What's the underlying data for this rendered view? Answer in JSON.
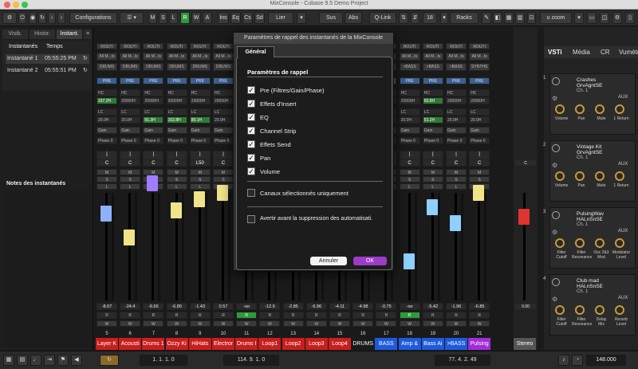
{
  "window": {
    "title": "MixConsole - Cubase 9.5 Demo Project"
  },
  "toolbar": {
    "configurations": "Configurations",
    "modes": [
      "M",
      "S",
      "L",
      "R",
      "W",
      "A"
    ],
    "ins": "Ins",
    "eq": "Eq",
    "cs": "Cs",
    "sd": "Sd",
    "link": "Lier",
    "sus": "Sus",
    "abs": "Abs",
    "qlink": "Q-Link",
    "channels": "18",
    "racks": "Racks",
    "zoom": "u zoom"
  },
  "left": {
    "tabs": [
      "Visib.",
      "Histor.",
      "Instant."
    ],
    "headers": [
      "Instantanés",
      "Temps"
    ],
    "snapshots": [
      {
        "name": "Instantané 1",
        "time": "05:55:25 PM"
      },
      {
        "name": "Instantané 2",
        "time": "05:55:51 PM"
      }
    ],
    "notes_label": "Notes des instantanés"
  },
  "colors": {
    "accent": "#2e9a3a",
    "dialog_ok": "#9b3cc7"
  },
  "channels": [
    {
      "num": "5",
      "name": "Layer K",
      "color": "#c81e1e",
      "fader_color": "#8fb0ff",
      "level": "-8.07",
      "peak": "-1.5",
      "pan": "C"
    },
    {
      "num": "6",
      "name": "Acousti",
      "color": "#c81e1e",
      "fader_color": "#f0e38a",
      "level": "-24.4",
      "peak": "-20.3",
      "pan": "C"
    },
    {
      "num": "7",
      "name": "Drums 1",
      "color": "#c81e1e",
      "fader_color": "#a27bff",
      "level": "-6.65",
      "peak": "-4.56",
      "pan": "C"
    },
    {
      "num": "8",
      "name": "Ozzy Ki",
      "color": "#c81e1e",
      "fader_color": "#f0e38a",
      "level": "-6.89",
      "peak": "-5.7",
      "pan": "C"
    },
    {
      "num": "9",
      "name": "HiHats",
      "color": "#c81e1e",
      "fader_color": "#f0e38a",
      "level": "-1.43",
      "peak": "-1.43",
      "pan": "L50"
    },
    {
      "num": "10",
      "name": "Electror",
      "color": "#c81e1e",
      "fader_color": "#f0e38a",
      "level": "0.57",
      "peak": "-6.6",
      "pan": "C"
    },
    {
      "num": "11",
      "name": "Drums I",
      "color": "#c81e1e",
      "fader_color": "#a34fd8",
      "level": "-oo",
      "peak": "-oo",
      "pan": "C"
    },
    {
      "num": "12",
      "name": "Loop1",
      "color": "#c81e1e",
      "fader_color": "#f0e38a",
      "level": "-12.9",
      "peak": "-oo",
      "pan": "C"
    },
    {
      "num": "13",
      "name": "Loop2",
      "color": "#c81e1e",
      "fader_color": "#f0e38a",
      "level": "-2.85",
      "peak": "-oo",
      "pan": "C"
    },
    {
      "num": "14",
      "name": "Loop3",
      "color": "#c81e1e",
      "fader_color": "#f0e38a",
      "level": "-6.96",
      "peak": "-oo",
      "pan": "C"
    },
    {
      "num": "15",
      "name": "Loop4",
      "color": "#c81e1e",
      "fader_color": "#f0e38a",
      "level": "-4.11",
      "peak": "-oo",
      "pan": "C"
    },
    {
      "num": "16",
      "name": "DRUMS",
      "color": "#1a1a1a",
      "fader_color": "#f0e38a",
      "level": "-4.98",
      "peak": "-5.6",
      "pan": "C"
    },
    {
      "num": "17",
      "name": "BASS",
      "color": "#1e5adc",
      "fader_color": "#8fd0ff",
      "level": "-0.75",
      "peak": "-7.9",
      "pan": "C"
    },
    {
      "num": "18",
      "name": "Amp &",
      "color": "#1e5adc",
      "fader_color": "#8fd0ff",
      "level": "-oo",
      "peak": "-29.3",
      "pan": "C"
    },
    {
      "num": "19",
      "name": "Bass Ai",
      "color": "#1e5adc",
      "fader_color": "#8fd0ff",
      "level": "-5.42",
      "peak": "-12.5",
      "pan": "C"
    },
    {
      "num": "20",
      "name": ">BASS",
      "color": "#1e5adc",
      "fader_color": "#8fd0ff",
      "level": "-1.96",
      "peak": "-9.6",
      "pan": "C"
    },
    {
      "num": "21",
      "name": "Pulsing",
      "color": "#a02dd8",
      "fader_color": "#f0e38a",
      "level": "-6.85",
      "peak": "-8.99",
      "pan": "C"
    }
  ],
  "stereo": {
    "name": "Stereo",
    "level": "0.00",
    "peak": "-0.00",
    "pan": "C"
  },
  "rack_labels": {
    "routing": "ROUTI",
    "all_mi": "All M...ts",
    "drums": "DRUMS",
    "bass": ">BASS",
    "stereo": "Stereo",
    "synths": "SYNTHS",
    "pre": "PRE",
    "hc": "HC",
    "lc": "LC",
    "hc_val": "20000H",
    "lc_val": "20.0H",
    "lc_hi": "91.3H",
    "lc_hi2": "152.8H",
    "lc_hi3": "80.1H",
    "lc_hi4": "51.2H",
    "hc_lo": "167.2H",
    "hc_lo2": "60.8H",
    "gain": "Gain",
    "phase": "Phase 0"
  },
  "dialog": {
    "title": "Paramètres de rappel des instantanés de la MixConsole",
    "tab": "Général",
    "group": "Paramètres de rappel",
    "options": [
      {
        "label": "Pre (Filtres/Gain/Phase)",
        "checked": true
      },
      {
        "label": "Effets d'Insert",
        "checked": true
      },
      {
        "label": "EQ",
        "checked": true
      },
      {
        "label": "Channel Strip",
        "checked": true
      },
      {
        "label": "Effets Send",
        "checked": true
      },
      {
        "label": "Pan",
        "checked": true
      },
      {
        "label": "Volume",
        "checked": true
      }
    ],
    "selected_only": "Canaux sélectionnés uniquement",
    "warn": "Avertir avant la suppression des automatisati.",
    "cancel": "Annuler",
    "ok": "OK"
  },
  "vstack": {
    "tabs": [
      "VSTi",
      "Média",
      "CR",
      "Vumètre"
    ],
    "instruments": [
      {
        "num": "1",
        "name": "Crashes\nGrvAgntSE",
        "ch": "Ch. 1",
        "knobs": [
          "Volume",
          "Pan",
          "Mute",
          "1 Return"
        ]
      },
      {
        "num": "2",
        "name": "Vintage Kit\nGrvAgntSE",
        "ch": "Ch. 1",
        "knobs": [
          "Volume",
          "Pan",
          "Mute",
          "1 Return"
        ]
      },
      {
        "num": "3",
        "name": "PulsingWav\nHALnSnSE",
        "ch": "Ch. 1",
        "knobs": [
          "Filter\nCutoff",
          "Filter\nResonance",
          "Osc 2&3\nMod",
          "Modulator\nLevel"
        ]
      },
      {
        "num": "4",
        "name": "Club mad\nHALnSnSE",
        "ch": "Ch. 1",
        "knobs": [
          "Filter\nCutoff",
          "Filter\nResonance",
          "Delay\nMix",
          "Reverb\nLevel"
        ]
      }
    ],
    "aux": "AUX"
  },
  "bottom": {
    "pos1": "1. 1. 1. 0",
    "pos2": "114. 9. 1. 0",
    "pos3": "77. 4. 2. 49",
    "tempo": "148.000"
  }
}
